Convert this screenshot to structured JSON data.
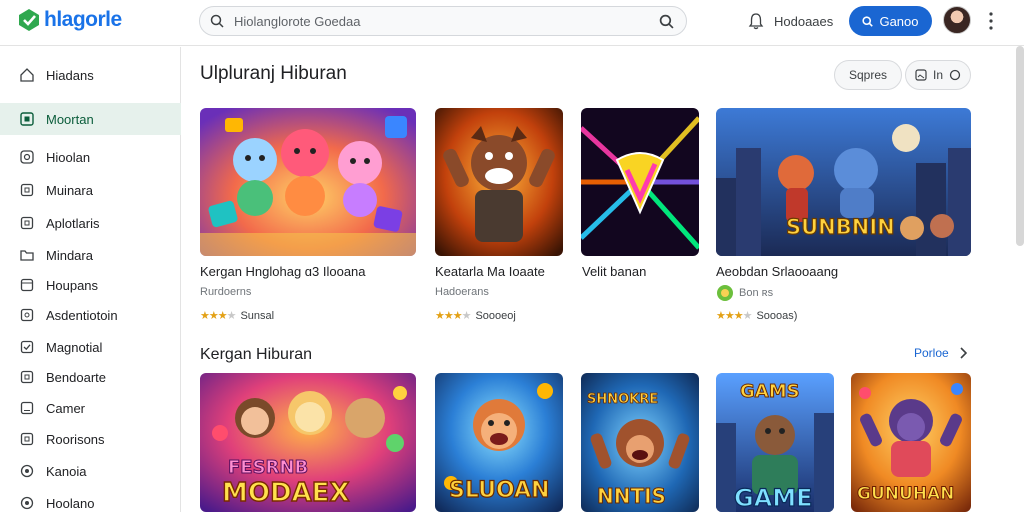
{
  "app": {
    "logo_text": "hlagorle",
    "brand_color": "#1a73e8",
    "accent_color": "#1a66d2"
  },
  "header": {
    "search_placeholder": "Hiolanglorote Goedaa",
    "link_label": "Hodoaaes",
    "primary_button_label": "Ganoo"
  },
  "sidebar": {
    "items": [
      {
        "label": "Hiadans",
        "icon": "home-icon"
      },
      {
        "label": "Moortan",
        "icon": "grid-icon",
        "active": true
      },
      {
        "label": "Hioolan",
        "icon": "clock-icon"
      },
      {
        "label": "Muinara",
        "icon": "square-icon"
      },
      {
        "label": "Aplotlaris",
        "icon": "square-icon"
      },
      {
        "label": "Mindara",
        "icon": "folder-icon"
      },
      {
        "label": "Houpans",
        "icon": "frame-icon"
      },
      {
        "label": "Asdentiotoin",
        "icon": "square-icon"
      },
      {
        "label": "Magnotial",
        "icon": "check-icon"
      },
      {
        "label": "Bendoarte",
        "icon": "square-icon"
      },
      {
        "label": "Camer",
        "icon": "square-icon"
      },
      {
        "label": "Roorisons",
        "icon": "square-icon"
      },
      {
        "label": "Kanoia",
        "icon": "circle-icon"
      },
      {
        "label": "Hoolano",
        "icon": "circle-icon"
      }
    ]
  },
  "section1": {
    "title": "Ulpluranj Hiburan",
    "chip1": "Sqpres",
    "chip2": "In",
    "cards": [
      {
        "title": "Kergan Hnglohag ɑ3 Ilooana",
        "subtitle": "Rurdoerns",
        "rating_label": "Sunsal"
      },
      {
        "title": "Keatarla Ma Ioaate",
        "subtitle": "Hadoerans",
        "rating_label": "Soooeoj"
      },
      {
        "title": "Velit banan",
        "subtitle": "",
        "rating_label": ""
      },
      {
        "title": "Aeobdan Srlaooaang",
        "subtitle": "Bon ʀs",
        "rating_label": "Soooas)"
      }
    ]
  },
  "section2": {
    "title": "Kergan Hiburan",
    "more_label": "Porloe",
    "tiles": [
      {
        "overlay": "MODAEX",
        "overlay_top": "FESRNB"
      },
      {
        "overlay": "SLUOAN",
        "overlay_top": ""
      },
      {
        "overlay": "NNTIS",
        "overlay_top": "SHNOKRE"
      },
      {
        "overlay": "GAME",
        "overlay_top": "GAMS"
      },
      {
        "overlay": "GUNUHAN",
        "overlay_top": ""
      }
    ]
  },
  "featured_tile": {
    "overlay": "SUNBNIN"
  }
}
